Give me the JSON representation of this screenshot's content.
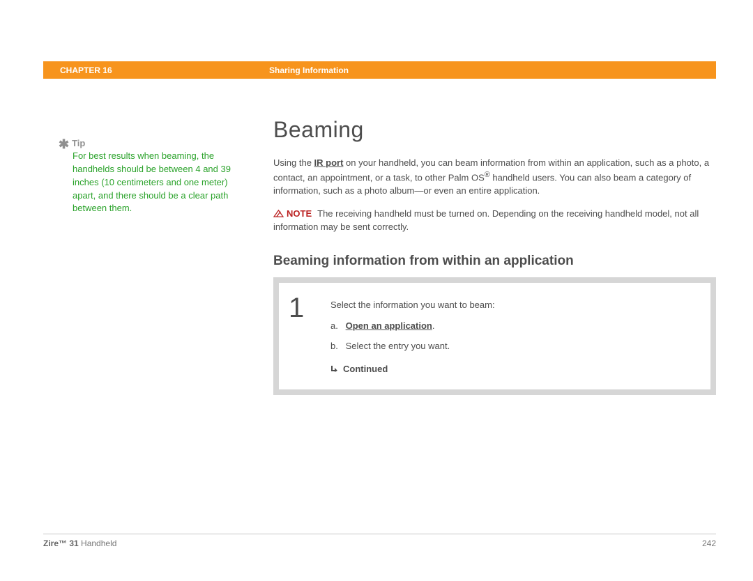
{
  "header": {
    "chapter_label": "CHAPTER 16",
    "breadcrumb": "Sharing Information"
  },
  "sidebar": {
    "tip_label": "Tip",
    "tip_body": "For best results when beaming, the handhelds should be between 4 and 39 inches (10 centimeters and one meter) apart, and there should be a clear path between them."
  },
  "main": {
    "title": "Beaming",
    "intro_pre": "Using the ",
    "intro_link": "IR port",
    "intro_post": " on your handheld, you can beam information from within an application, such as a photo, a contact, an appointment, or a task, to other Palm OS",
    "reg": "®",
    "intro_tail": " handheld users. You can also beam a category of information, such as a photo album—or even an entire application.",
    "note_label": "NOTE",
    "note_text": "The receiving handheld must be turned on. Depending on the receiving handheld model, not all information may be sent correctly.",
    "subhead": "Beaming information from within an application",
    "step_number": "1",
    "step_lead": "Select the information you want to beam:",
    "step_a_label": "a.",
    "step_a_text": "Open an application",
    "step_a_suffix": ".",
    "step_b_label": "b.",
    "step_b_text": "Select the entry you want.",
    "continued": "Continued"
  },
  "footer": {
    "product_bold": "Zire™ 31",
    "product_rest": " Handheld",
    "page": "242"
  }
}
